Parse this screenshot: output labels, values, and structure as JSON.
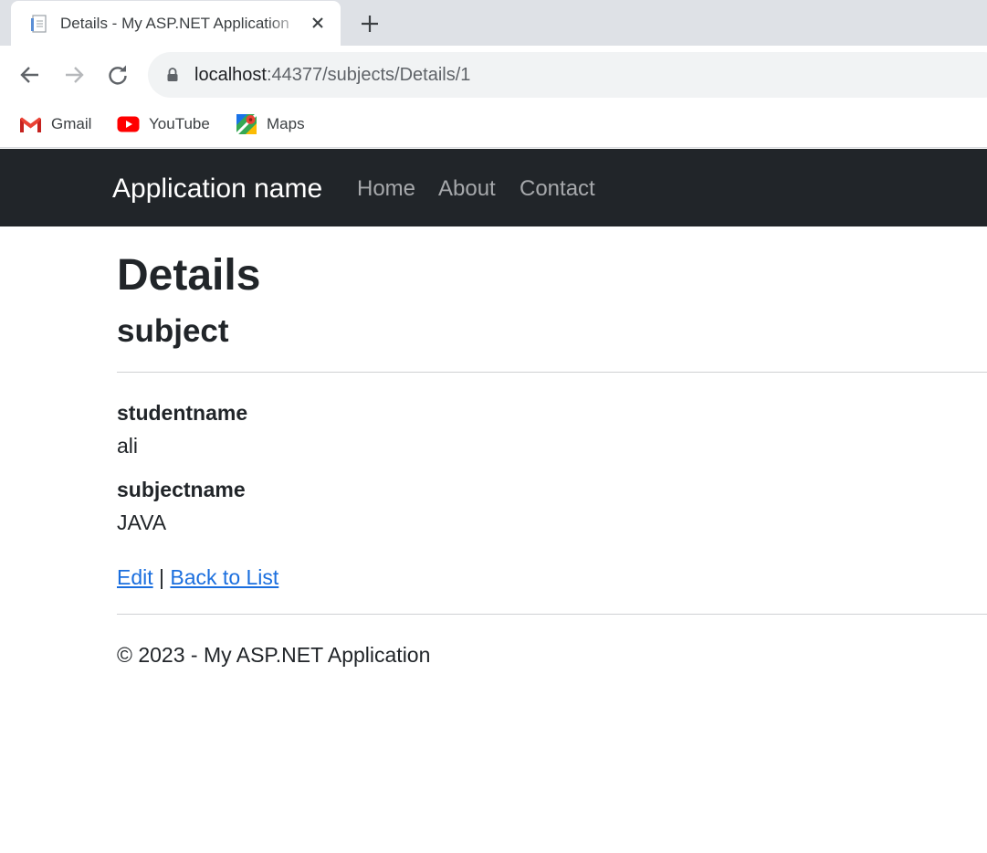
{
  "browser": {
    "tab": {
      "title": "Details - My ASP.NET Application",
      "favicon": "document-icon",
      "close": "close-icon"
    },
    "new_tab": "plus-icon",
    "toolbar": {
      "back": "back-arrow-icon",
      "forward": "forward-arrow-icon",
      "reload": "reload-icon",
      "lock": "lock-icon"
    },
    "address_bar": {
      "host": "localhost",
      "path": ":44377/subjects/Details/1"
    },
    "bookmarks": [
      {
        "label": "Gmail",
        "icon": "gmail-icon"
      },
      {
        "label": "YouTube",
        "icon": "youtube-icon"
      },
      {
        "label": "Maps",
        "icon": "maps-icon"
      }
    ]
  },
  "navbar": {
    "brand": "Application name",
    "links": [
      "Home",
      "About",
      "Contact"
    ],
    "background": "#212529"
  },
  "page": {
    "heading": "Details",
    "subheading": "subject",
    "fields": [
      {
        "label": "studentname",
        "value": "ali"
      },
      {
        "label": "subjectname",
        "value": "JAVA"
      }
    ],
    "actions": {
      "edit": "Edit",
      "separator": "|",
      "back": "Back to List"
    },
    "footer": "© 2023 - My ASP.NET Application",
    "link_color": "#1a6ede"
  }
}
